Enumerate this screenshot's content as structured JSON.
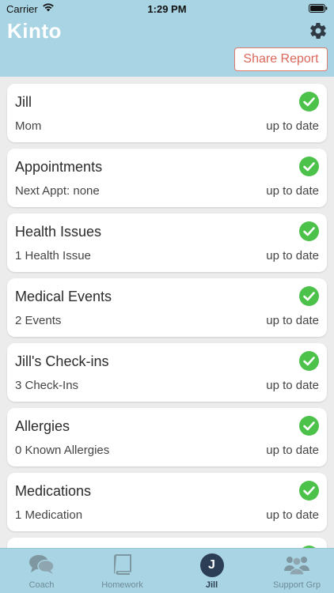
{
  "status_bar": {
    "carrier": "Carrier",
    "time": "1:29 PM"
  },
  "header": {
    "logo": "Kinto",
    "share_label": "Share Report",
    "settings_icon": "gear-icon"
  },
  "colors": {
    "header_bg": "#a8d4e3",
    "accent_red": "#d9685b",
    "check_green": "#4cc24b",
    "avatar_bg": "#2c3e55"
  },
  "cards": [
    {
      "title": "Jill",
      "subtitle": "Mom",
      "status": "up to date",
      "icon": "check-circle-icon"
    },
    {
      "title": "Appointments",
      "subtitle": "Next Appt: none",
      "status": "up to date",
      "icon": "check-circle-icon"
    },
    {
      "title": "Health Issues",
      "subtitle": "1 Health Issue",
      "status": "up to date",
      "icon": "check-circle-icon"
    },
    {
      "title": "Medical Events",
      "subtitle": "2 Events",
      "status": "up to date",
      "icon": "check-circle-icon"
    },
    {
      "title": "Jill's Check-ins",
      "subtitle": "3 Check-Ins",
      "status": "up to date",
      "icon": "check-circle-icon"
    },
    {
      "title": "Allergies",
      "subtitle": "0 Known Allergies",
      "status": "up to date",
      "icon": "check-circle-icon"
    },
    {
      "title": "Medications",
      "subtitle": "1 Medication",
      "status": "up to date",
      "icon": "check-circle-icon"
    }
  ],
  "tabs": [
    {
      "label": "Coach",
      "icon": "chat-bubbles-icon"
    },
    {
      "label": "Homework",
      "icon": "book-icon"
    },
    {
      "label": "Jill",
      "icon": "avatar",
      "avatar_letter": "J"
    },
    {
      "label": "Support Grp",
      "icon": "group-icon"
    }
  ]
}
